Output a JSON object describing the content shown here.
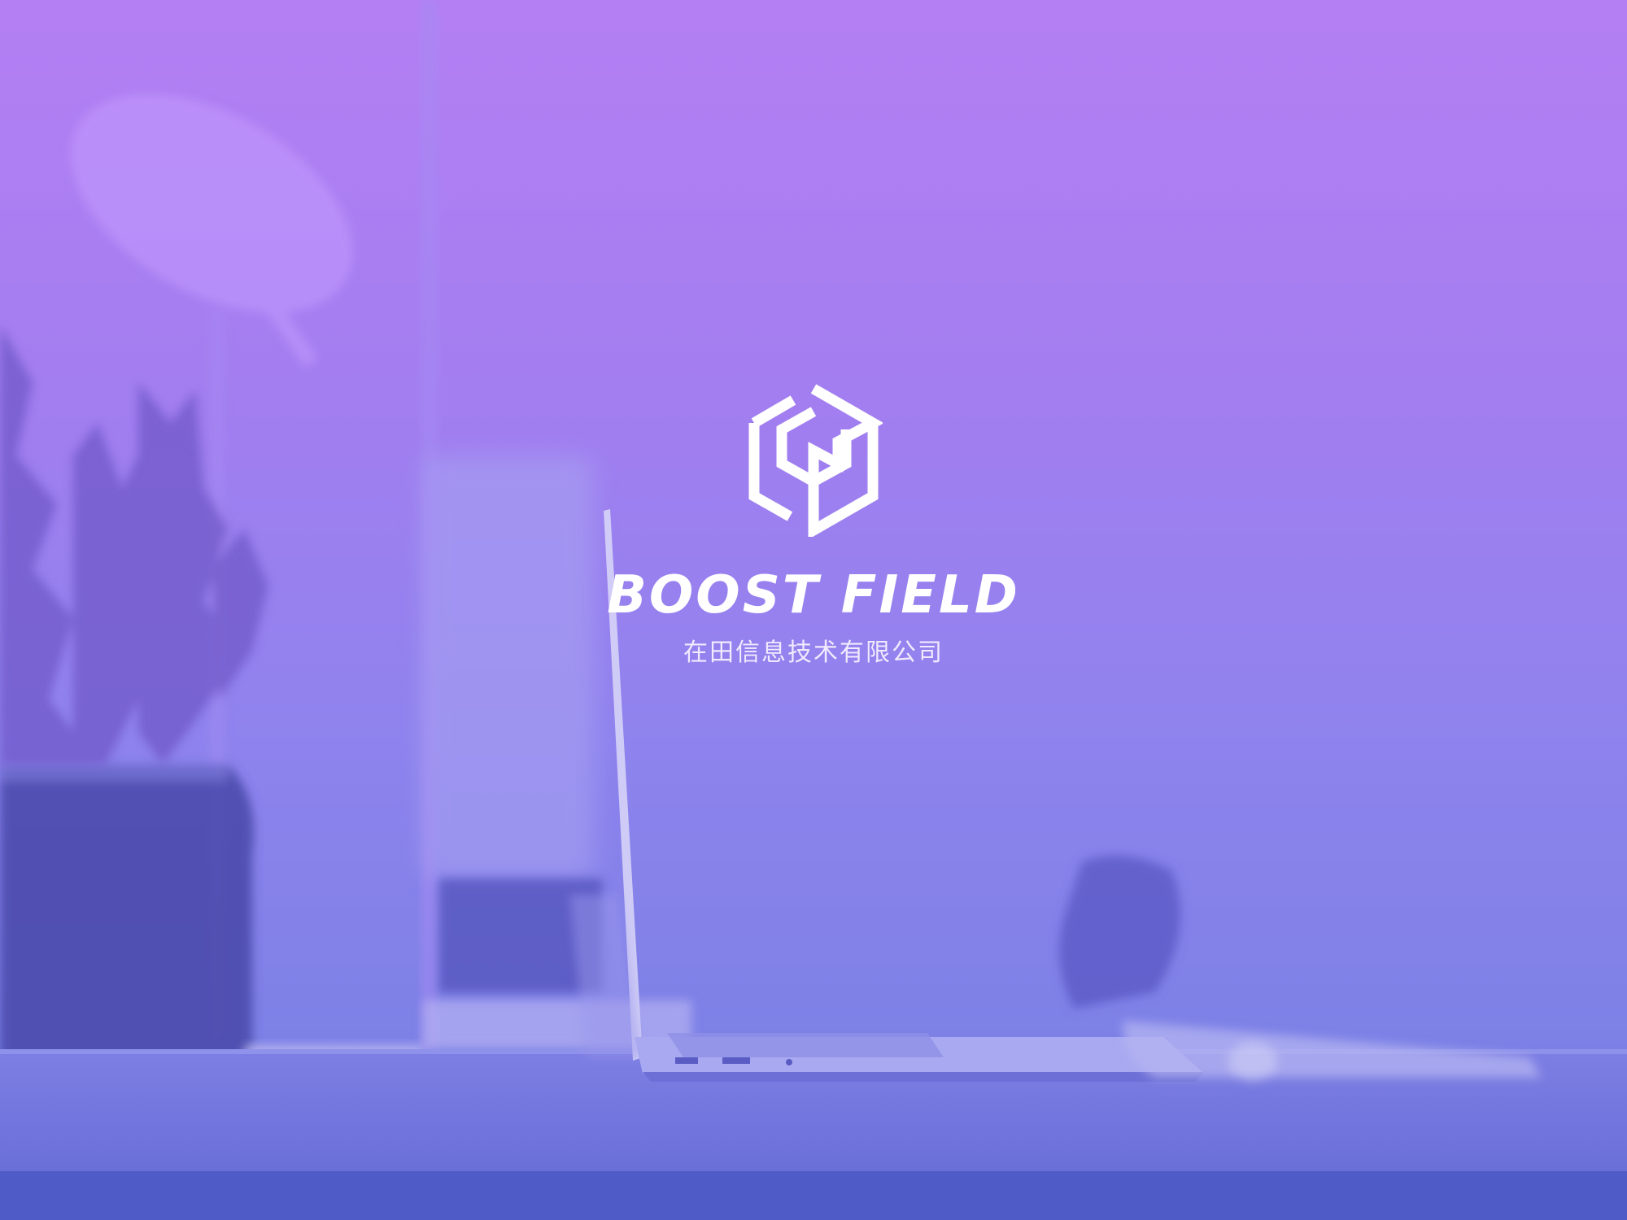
{
  "brand": {
    "name": "BOOST FIELD",
    "subtitle": "在田信息技术有限公司",
    "logo_icon": "boost-field-hexagon-logo",
    "color_text": "#ffffff"
  },
  "background": {
    "description_icon": "blurred-office-desk-photo",
    "overlay_top_color": "#b47ff3",
    "overlay_bottom_color": "#6f74dc"
  }
}
